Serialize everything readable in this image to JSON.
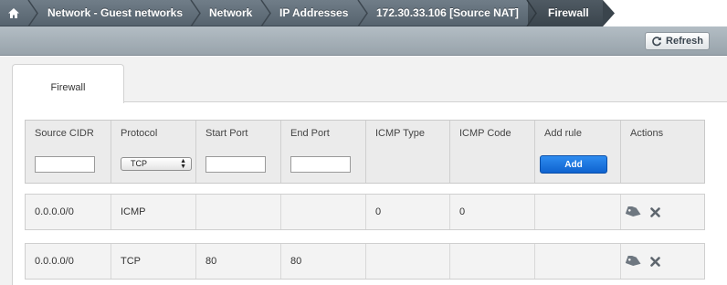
{
  "breadcrumb": {
    "home_icon": "home-icon",
    "items": [
      {
        "label": "Network - Guest networks"
      },
      {
        "label": "Network"
      },
      {
        "label": "IP Addresses"
      },
      {
        "label": "172.30.33.106 [Source NAT]"
      },
      {
        "label": "Firewall"
      }
    ]
  },
  "toolbar": {
    "refresh_label": "Refresh",
    "refresh_icon": "refresh-icon"
  },
  "tabs": [
    {
      "label": "Firewall"
    }
  ],
  "table": {
    "columns": [
      "Source CIDR",
      "Protocol",
      "Start Port",
      "End Port",
      "ICMP Type",
      "ICMP Code",
      "Add rule",
      "Actions"
    ],
    "form": {
      "source_cidr": "",
      "protocol": "TCP",
      "start_port": "",
      "end_port": "",
      "add_label": "Add"
    },
    "rows": [
      {
        "source_cidr": "0.0.0.0/0",
        "protocol": "ICMP",
        "start_port": "",
        "end_port": "",
        "icmp_type": "0",
        "icmp_code": "0",
        "add_rule": ""
      },
      {
        "source_cidr": "0.0.0.0/0",
        "protocol": "TCP",
        "start_port": "80",
        "end_port": "80",
        "icmp_type": "",
        "icmp_code": "",
        "add_rule": ""
      }
    ],
    "action_icons": [
      "tag-icon",
      "delete-icon"
    ]
  },
  "colors": {
    "breadcrumb_bg": "#56636e",
    "toolbar_bg": "#a4aeb6",
    "add_button": "#1a73e0"
  }
}
